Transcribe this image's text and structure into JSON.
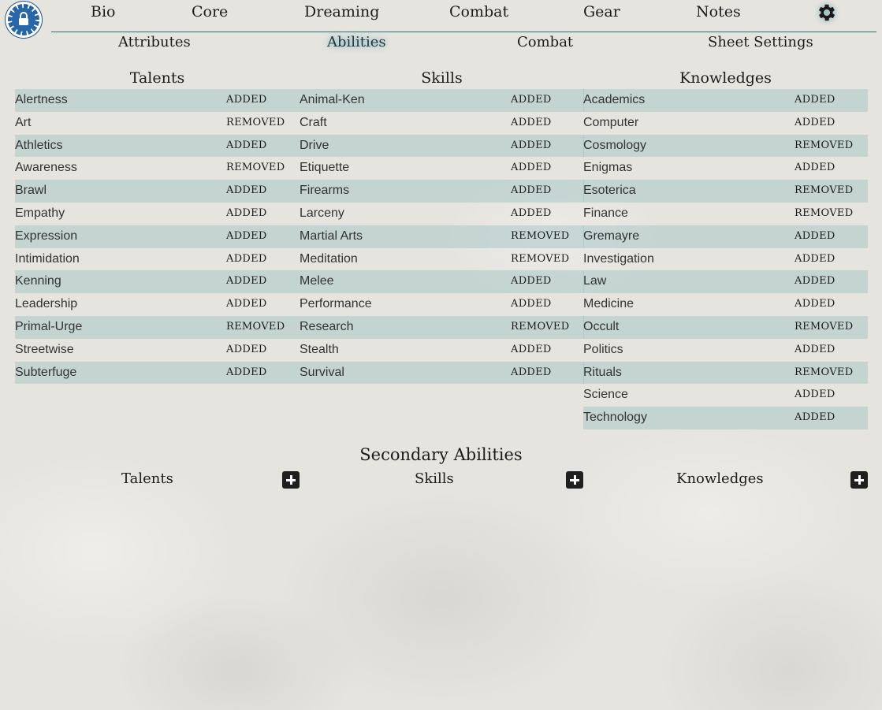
{
  "top_nav": {
    "items": [
      "Bio",
      "Core",
      "Dreaming",
      "Combat",
      "Gear",
      "Notes"
    ],
    "settings_icon": "gear-icon",
    "lock_icon": "lock-icon"
  },
  "sub_nav": {
    "items": [
      "Attributes",
      "Abilities",
      "Combat",
      "Sheet Settings"
    ],
    "active": "Abilities"
  },
  "abilities": {
    "talents": {
      "title": "Talents",
      "rows": [
        {
          "name": "Alertness",
          "status": "ADDED"
        },
        {
          "name": "Art",
          "status": "REMOVED"
        },
        {
          "name": "Athletics",
          "status": "ADDED"
        },
        {
          "name": "Awareness",
          "status": "REMOVED"
        },
        {
          "name": "Brawl",
          "status": "ADDED"
        },
        {
          "name": "Empathy",
          "status": "ADDED"
        },
        {
          "name": "Expression",
          "status": "ADDED"
        },
        {
          "name": "Intimidation",
          "status": "ADDED"
        },
        {
          "name": "Kenning",
          "status": "ADDED"
        },
        {
          "name": "Leadership",
          "status": "ADDED"
        },
        {
          "name": "Primal-Urge",
          "status": "REMOVED"
        },
        {
          "name": "Streetwise",
          "status": "ADDED"
        },
        {
          "name": "Subterfuge",
          "status": "ADDED"
        }
      ]
    },
    "skills": {
      "title": "Skills",
      "rows": [
        {
          "name": "Animal-Ken",
          "status": "ADDED"
        },
        {
          "name": "Craft",
          "status": "ADDED"
        },
        {
          "name": "Drive",
          "status": "ADDED"
        },
        {
          "name": "Etiquette",
          "status": "ADDED"
        },
        {
          "name": "Firearms",
          "status": "ADDED"
        },
        {
          "name": "Larceny",
          "status": "ADDED"
        },
        {
          "name": "Martial Arts",
          "status": "REMOVED"
        },
        {
          "name": "Meditation",
          "status": "REMOVED"
        },
        {
          "name": "Melee",
          "status": "ADDED"
        },
        {
          "name": "Performance",
          "status": "ADDED"
        },
        {
          "name": "Research",
          "status": "REMOVED"
        },
        {
          "name": "Stealth",
          "status": "ADDED"
        },
        {
          "name": "Survival",
          "status": "ADDED"
        }
      ]
    },
    "knowledges": {
      "title": "Knowledges",
      "rows": [
        {
          "name": "Academics",
          "status": "ADDED"
        },
        {
          "name": "Computer",
          "status": "ADDED"
        },
        {
          "name": "Cosmology",
          "status": "REMOVED"
        },
        {
          "name": "Enigmas",
          "status": "ADDED"
        },
        {
          "name": "Esoterica",
          "status": "REMOVED"
        },
        {
          "name": "Finance",
          "status": "REMOVED"
        },
        {
          "name": "Gremayre",
          "status": "ADDED"
        },
        {
          "name": "Investigation",
          "status": "ADDED"
        },
        {
          "name": "Law",
          "status": "ADDED"
        },
        {
          "name": "Medicine",
          "status": "ADDED"
        },
        {
          "name": "Occult",
          "status": "REMOVED"
        },
        {
          "name": "Politics",
          "status": "ADDED"
        },
        {
          "name": "Rituals",
          "status": "REMOVED"
        },
        {
          "name": "Science",
          "status": "ADDED"
        },
        {
          "name": "Technology",
          "status": "ADDED"
        }
      ]
    }
  },
  "secondary": {
    "title": "Secondary Abilities",
    "talents_label": "Talents",
    "skills_label": "Skills",
    "knowledges_label": "Knowledges"
  }
}
